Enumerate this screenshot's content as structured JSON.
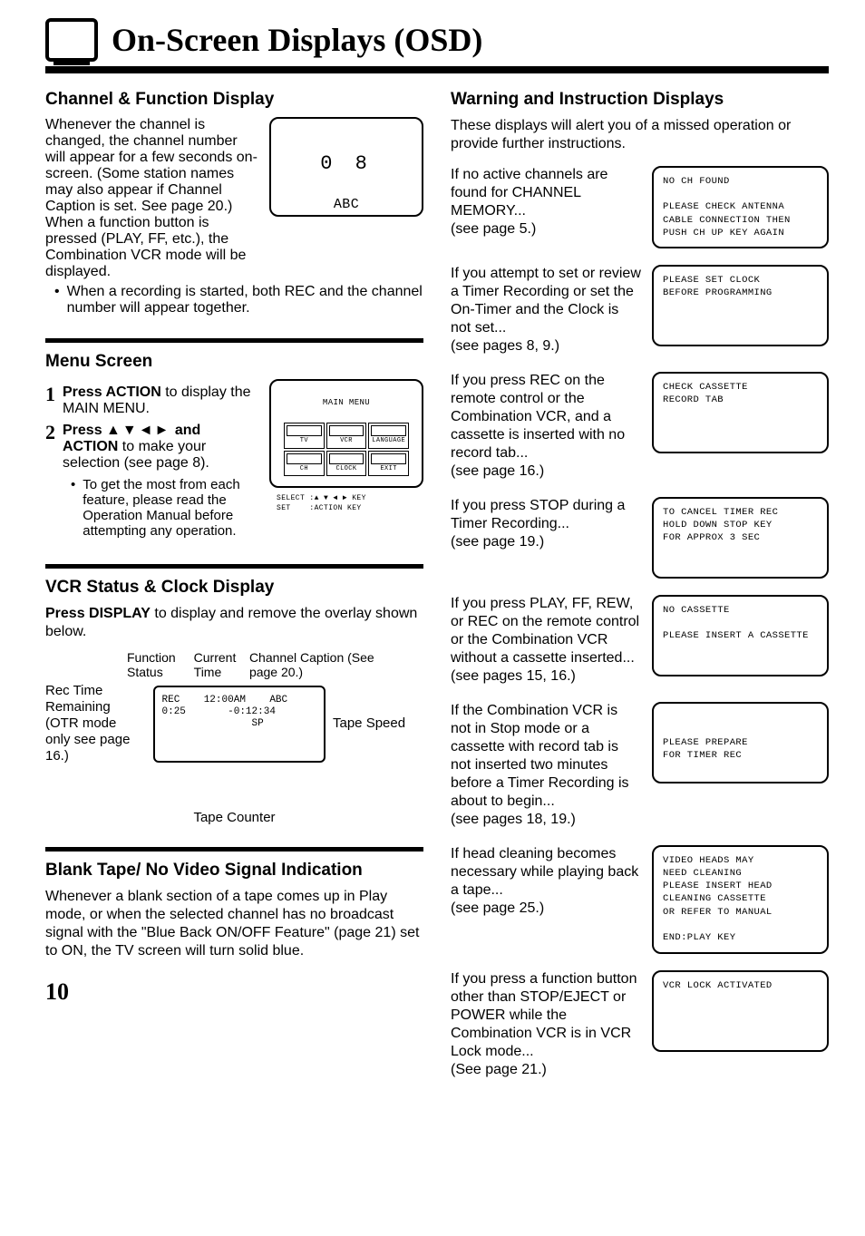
{
  "title": "On-Screen Displays (OSD)",
  "pageNumber": "10",
  "left": {
    "channel": {
      "heading": "Channel & Function Display",
      "para1": "Whenever the channel is changed, the channel number will appear for a few seconds on-screen. (Some station names may also appear if Channel Caption is set. See page 20.) When a function button is pressed (PLAY, FF, etc.), the Combination VCR mode will be displayed.",
      "osdNum": "0 8",
      "osdName": "ABC",
      "bullet": "When a recording is started, both REC and the channel number will appear together."
    },
    "menu": {
      "heading": "Menu Screen",
      "step1a": "Press ",
      "step1b": "ACTION",
      "step1c": " to display the MAIN MENU.",
      "step2a": "Press ",
      "step2arrows": "▲▼◄►",
      "step2b": " and ",
      "step2c": "ACTION",
      "step2d": " to make your selection (see page 8).",
      "subbullet": "To get the most from each feature, please read the Operation Manual before attempting any operation.",
      "osdTitle": "MAIN MENU",
      "osdItems": [
        "TV",
        "VCR",
        "LANGUAGE",
        "CH",
        "CLOCK",
        "EXIT"
      ],
      "osdFooter": "SELECT :▲ ▼ ◄ ► KEY\nSET    :ACTION KEY"
    },
    "vcr": {
      "heading": "VCR Status & Clock Display",
      "intro1": "Press ",
      "intro2": "DISPLAY",
      "intro3": " to display and remove the overlay shown below.",
      "labelTop1": "Function Status",
      "labelTop2": "Current Time",
      "labelTop3": "Channel Caption (See page 20.)",
      "labelLeft": "Rec Time Remaining (OTR mode only see page 16.)",
      "labelRight": "Tape Speed",
      "labelBottom": "Tape Counter",
      "osdContent": "REC    12:00AM    ABC\n0:25       -0:12:34\n               SP"
    },
    "blank": {
      "heading": "Blank Tape/ No Video Signal Indication",
      "para": "Whenever a blank section of a tape comes up in Play mode, or when the selected channel has no broadcast signal with the \"Blue Back ON/OFF Feature\" (page 21) set to ON, the TV screen will turn solid blue."
    }
  },
  "right": {
    "heading": "Warning and Instruction Displays",
    "intro": "These displays will alert you of a missed operation or provide further instructions.",
    "items": [
      {
        "text": "If no active channels are found for CHANNEL MEMORY...\n(see page 5.)",
        "osd": "NO CH FOUND\n\nPLEASE CHECK ANTENNA\nCABLE CONNECTION THEN\nPUSH CH UP KEY AGAIN"
      },
      {
        "text": "If you attempt to set or review a Timer Recording or set the On-Timer and the Clock is not set...\n(see pages 8, 9.)",
        "osd": "PLEASE SET CLOCK\nBEFORE PROGRAMMING"
      },
      {
        "text": "If you press REC on the remote control or the Combination VCR, and a cassette is inserted with no record tab...\n(see page 16.)",
        "osd": "CHECK CASSETTE\nRECORD TAB"
      },
      {
        "text": "If you press STOP during a Timer Recording...\n(see page 19.)",
        "osd": "TO CANCEL TIMER REC\nHOLD DOWN STOP KEY\nFOR APPROX 3 SEC"
      },
      {
        "text": "If you press PLAY, FF, REW, or REC on the remote control or the Combination VCR without a cassette inserted...\n(see pages 15, 16.)",
        "osd": "NO CASSETTE\n\nPLEASE INSERT A CASSETTE"
      },
      {
        "text": "If the Combination VCR is not in Stop mode or a cassette with record tab is not inserted two minutes before a Timer Recording is about to begin...\n(see pages 18, 19.)",
        "osd": "\n\n      PLEASE PREPARE\n      FOR TIMER REC"
      },
      {
        "text": "If head cleaning becomes necessary while playing back a tape...\n(see page 25.)",
        "osd": "VIDEO HEADS MAY\nNEED CLEANING\nPLEASE INSERT HEAD\nCLEANING CASSETTE\nOR REFER TO MANUAL\n\nEND:PLAY KEY"
      },
      {
        "text": "If you press a function button other than STOP/EJECT or POWER while the Combination VCR is in VCR Lock mode...\n(See page 21.)",
        "osd": "VCR LOCK ACTIVATED"
      }
    ]
  }
}
